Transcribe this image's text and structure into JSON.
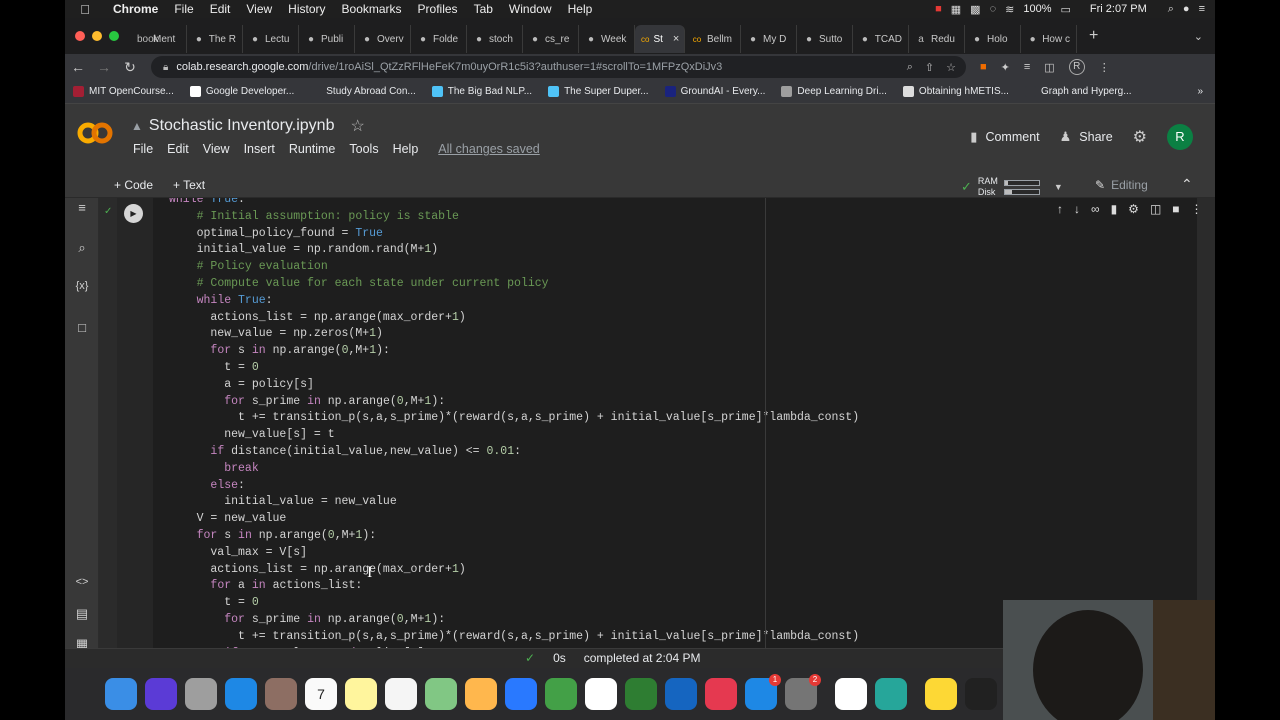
{
  "menubar": {
    "apple": "",
    "app": "Chrome",
    "items": [
      "File",
      "Edit",
      "View",
      "History",
      "Bookmarks",
      "Profiles",
      "Tab",
      "Window",
      "Help"
    ],
    "battery": "100%",
    "clock": "Fri 2:07 PM"
  },
  "tabs": [
    {
      "icon": "book",
      "label": "Ment"
    },
    {
      "icon": "",
      "label": "The R"
    },
    {
      "icon": "",
      "label": "Lectu"
    },
    {
      "icon": "",
      "label": "Publi"
    },
    {
      "icon": "",
      "label": "Overv"
    },
    {
      "icon": "",
      "label": "Folde"
    },
    {
      "icon": "",
      "label": "stoch"
    },
    {
      "icon": "",
      "label": "cs_re"
    },
    {
      "icon": "",
      "label": "Week"
    },
    {
      "icon": "co",
      "label": "St",
      "active": true
    },
    {
      "icon": "co",
      "label": "Bellm"
    },
    {
      "icon": "",
      "label": "My D"
    },
    {
      "icon": "",
      "label": "Sutto"
    },
    {
      "icon": "",
      "label": "TCAD"
    },
    {
      "icon": "a",
      "label": "Redu"
    },
    {
      "icon": "",
      "label": "Holo"
    },
    {
      "icon": "",
      "label": "How c"
    }
  ],
  "address": {
    "host": "colab.research.google.com",
    "path": "/drive/1roAiSl_QtZzRFlHeFeK7m0uyOrR1c5i3?authuser=1#scrollTo=1MFPzQxDiJv3"
  },
  "profile_letter": "R",
  "bookmarks": [
    {
      "label": "MIT OpenCourse...",
      "color": "#a31f34"
    },
    {
      "label": "Google Developer...",
      "color": "#ffffff"
    },
    {
      "label": "Study Abroad Con...",
      "color": "#35363a"
    },
    {
      "label": "The Big Bad NLP...",
      "color": "#4fc3f7"
    },
    {
      "label": "The Super Duper...",
      "color": "#4fc3f7"
    },
    {
      "label": "GroundAI - Every...",
      "color": "#1a237e"
    },
    {
      "label": "Deep Learning Dri...",
      "color": "#9e9e9e"
    },
    {
      "label": "Obtaining hMETIS...",
      "color": "#dddddd"
    },
    {
      "label": "Graph and Hyperg...",
      "color": "#35363a"
    }
  ],
  "colab": {
    "title": "Stochastic Inventory.ipynb",
    "menu": [
      "File",
      "Edit",
      "View",
      "Insert",
      "Runtime",
      "Tools",
      "Help"
    ],
    "saved": "All changes saved",
    "comment": "Comment",
    "share": "Share",
    "user": "R",
    "add_code": "+ Code",
    "add_text": "+ Text",
    "ram": "RAM",
    "disk": "Disk",
    "ram_fill": 0.1,
    "disk_fill": 0.2,
    "editing": "Editing"
  },
  "status": {
    "time": "0s",
    "text": "completed at 2:04 PM"
  },
  "code_lines": [
    "while True:",
    "    # Initial assumption: policy is stable",
    "    optimal_policy_found = True",
    "    initial_value = np.random.rand(M+1)",
    "    # Policy evaluation",
    "    # Compute value for each state under current policy",
    "    while True:",
    "      actions_list = np.arange(max_order+1)",
    "      new_value = np.zeros(M+1)",
    "      for s in np.arange(0,M+1):",
    "        t = 0",
    "        a = policy[s]",
    "        for s_prime in np.arange(0,M+1):",
    "          t += transition_p(s,a,s_prime)*(reward(s,a,s_prime) + initial_value[s_prime]*lambda_const)",
    "        new_value[s] = t",
    "      if distance(initial_value,new_value) <= 0.01:",
    "        break",
    "      else:",
    "        initial_value = new_value",
    "    V = new_value",
    "    for s in np.arange(0,M+1):",
    "      val_max = V[s]",
    "      actions_list = np.arange(max_order+1)",
    "      for a in actions_list:",
    "        t = 0",
    "        for s_prime in np.arange(0,M+1):",
    "          t += transition_p(s,a,s_prime)*(reward(s,a,s_prime) + initial_value[s_prime]*lambda_const)",
    "        if t >= val_max and policy[s] != a:"
  ],
  "dock": [
    {
      "name": "finder",
      "color": "#3a8ee6"
    },
    {
      "name": "siri",
      "color": "#5b3bd6"
    },
    {
      "name": "launchpad",
      "color": "#9e9e9e"
    },
    {
      "name": "safari",
      "color": "#1e88e5"
    },
    {
      "name": "notes-book",
      "color": "#8d6e63"
    },
    {
      "name": "calendar",
      "color": "#fafafa",
      "label": "7"
    },
    {
      "name": "notes",
      "color": "#fff59d"
    },
    {
      "name": "reminders",
      "color": "#f5f5f5"
    },
    {
      "name": "maps",
      "color": "#81c784"
    },
    {
      "name": "photos",
      "color": "#ffb74d"
    },
    {
      "name": "messages",
      "color": "#2979ff"
    },
    {
      "name": "facetime",
      "color": "#43a047"
    },
    {
      "name": "freeform",
      "color": "#ffffff"
    },
    {
      "name": "numbers",
      "color": "#2e7d32"
    },
    {
      "name": "keynote",
      "color": "#1565c0"
    },
    {
      "name": "music",
      "color": "#e53950"
    },
    {
      "name": "app-store",
      "color": "#1e88e5",
      "badge": "1"
    },
    {
      "name": "system-prefs",
      "color": "#757575",
      "badge": "2"
    },
    {
      "name": "chrome",
      "color": "#ffffff"
    },
    {
      "name": "atom",
      "color": "#26a69a"
    },
    {
      "name": "stickies",
      "color": "#fdd835"
    },
    {
      "name": "terminal",
      "color": "#212121"
    }
  ]
}
